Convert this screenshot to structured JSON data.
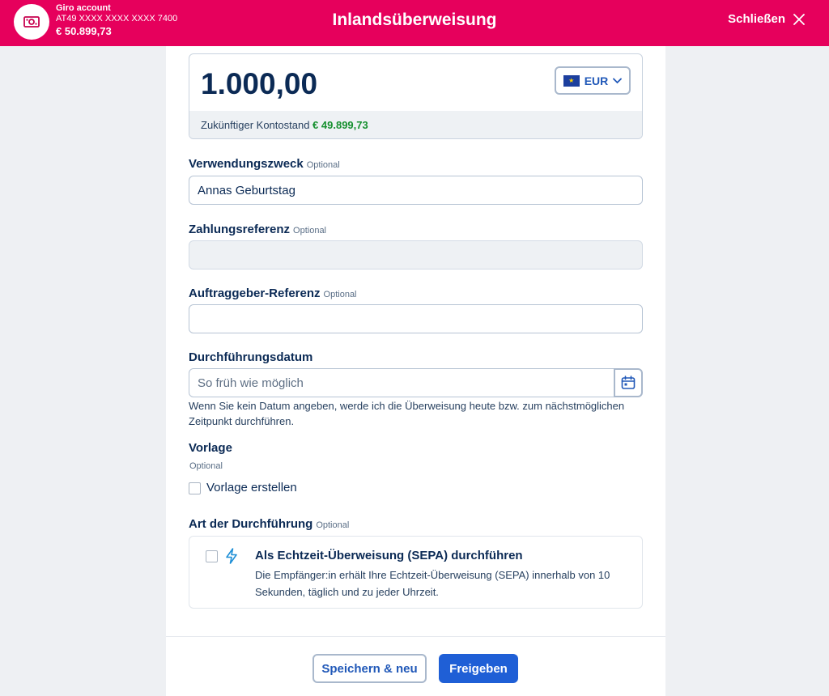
{
  "header": {
    "account_name": "Giro account",
    "account_iban": "AT49 XXXX XXXX XXXX 7400",
    "account_balance": "€ 50.899,73",
    "title": "Inlandsüberweisung",
    "close_label": "Schließen"
  },
  "amount": {
    "value": "1.000,00",
    "currency": "EUR",
    "future_balance_label": "Zukünftiger Kontostand",
    "future_balance_value": "€ 49.899,73"
  },
  "fields": {
    "purpose": {
      "label": "Verwendungszweck",
      "optional": "Optional",
      "value": "Annas Geburtstag"
    },
    "payment_reference": {
      "label": "Zahlungsreferenz",
      "optional": "Optional",
      "value": ""
    },
    "customer_reference": {
      "label": "Auftraggeber-Referenz",
      "optional": "Optional",
      "value": ""
    },
    "execution_date": {
      "label": "Durchführungsdatum",
      "placeholder": "So früh wie möglich",
      "help": "Wenn Sie kein Datum angeben, werde ich die Überweisung heute bzw. zum nächstmöglichen Zeitpunkt durchführen."
    }
  },
  "template": {
    "label": "Vorlage",
    "optional": "Optional",
    "checkbox_label": "Vorlage erstellen"
  },
  "execution_type": {
    "label": "Art der Durchführung",
    "optional": "Optional",
    "instant_title": "Als Echtzeit-Überweisung (SEPA) durchführen",
    "instant_desc": "Die Empfänger:in erhält Ihre Echtzeit-Überweisung (SEPA) innerhalb von 10 Sekunden, täglich und zu jeder Uhrzeit."
  },
  "actions": {
    "save_new": "Speichern & neu",
    "release": "Freigeben"
  },
  "colors": {
    "brand": "#e6005c",
    "primary": "#1f5fd6",
    "positive": "#16902f",
    "text": "#0b2a55"
  }
}
